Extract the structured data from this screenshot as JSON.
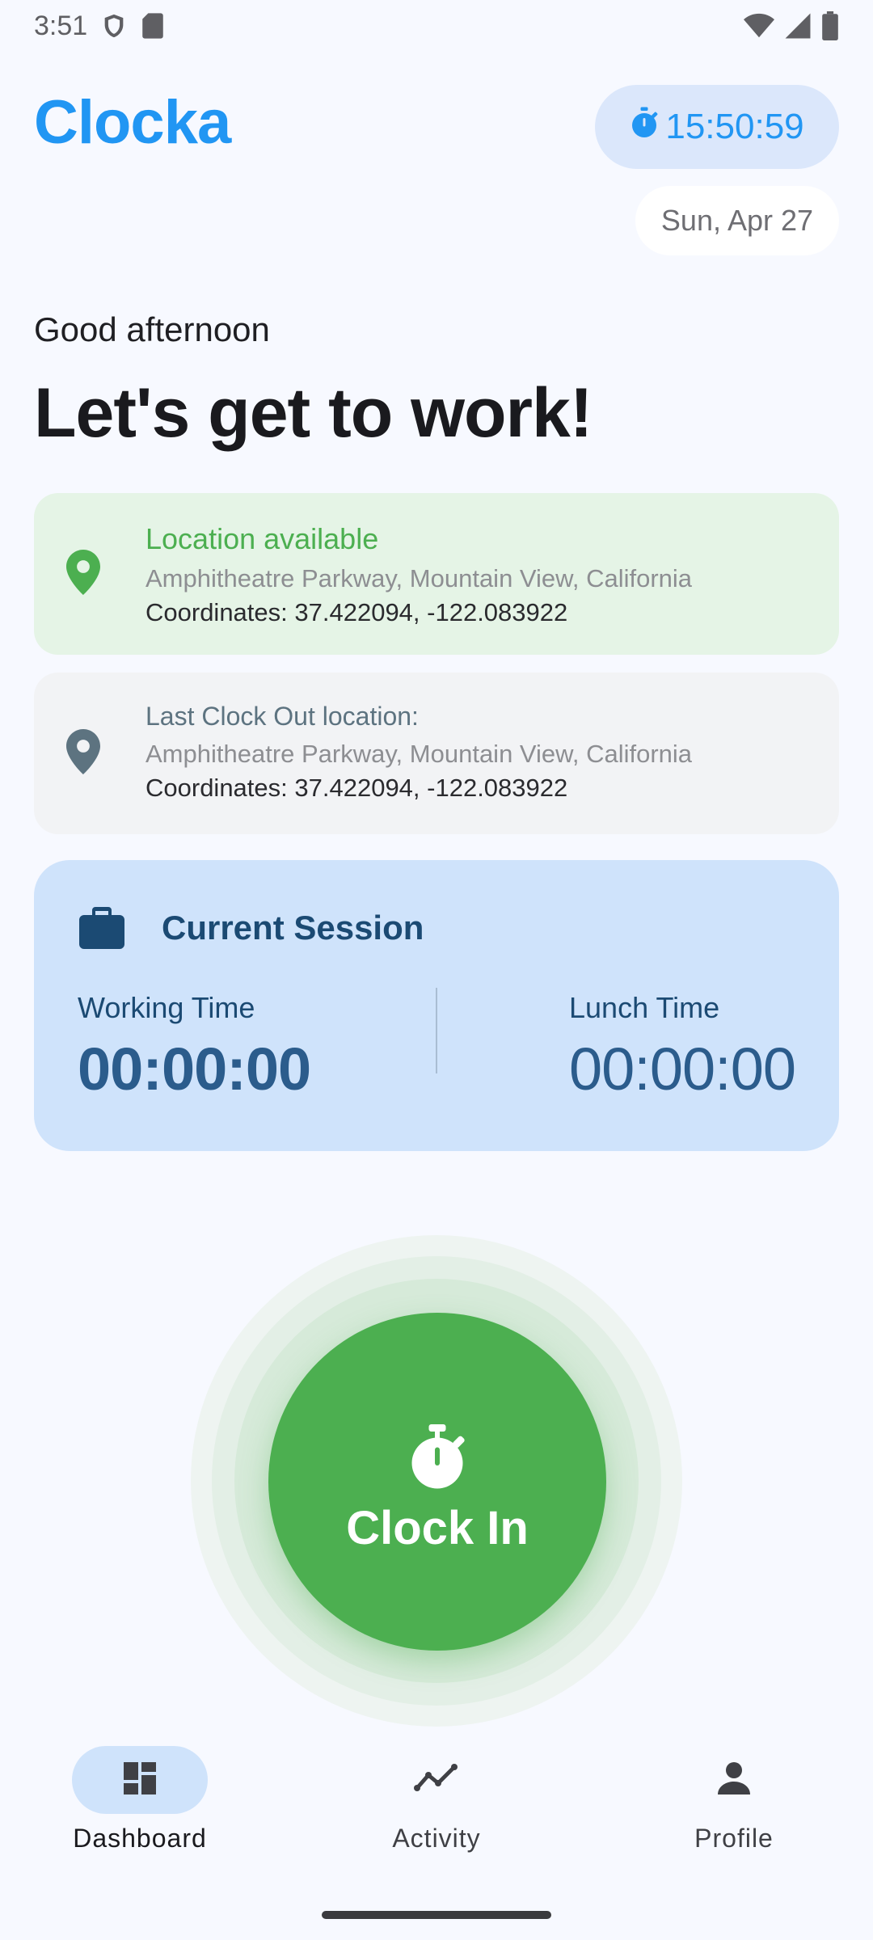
{
  "status_bar": {
    "time": "3:51",
    "icons": [
      "shield-icon",
      "sd-card-icon",
      "wifi-icon",
      "signal-icon",
      "battery-icon"
    ]
  },
  "header": {
    "app_name": "Clocka",
    "live_clock": "15:50:59",
    "date": "Sun, Apr 27"
  },
  "greeting": {
    "salutation": "Good afternoon",
    "headline": "Let's get to work!"
  },
  "location_current": {
    "status": "Location available",
    "address": "Amphitheatre Parkway, Mountain View, California",
    "coordinates": "Coordinates: 37.422094, -122.083922"
  },
  "location_last": {
    "label": "Last Clock Out location:",
    "address": "Amphitheatre Parkway, Mountain View, California",
    "coordinates": "Coordinates: 37.422094, -122.083922"
  },
  "session": {
    "title": "Current Session",
    "working_label": "Working Time",
    "working_value": "00:00:00",
    "lunch_label": "Lunch Time",
    "lunch_value": "00:00:00"
  },
  "clock_in": {
    "label": "Clock In"
  },
  "nav": {
    "items": [
      {
        "label": "Dashboard",
        "icon": "dashboard-icon",
        "active": true
      },
      {
        "label": "Activity",
        "icon": "activity-icon",
        "active": false
      },
      {
        "label": "Profile",
        "icon": "profile-icon",
        "active": false
      }
    ]
  },
  "colors": {
    "brand": "#2196f3",
    "success": "#4caf50",
    "session_bg": "#cfe3fb",
    "location_bg": "#e5f4e6"
  }
}
